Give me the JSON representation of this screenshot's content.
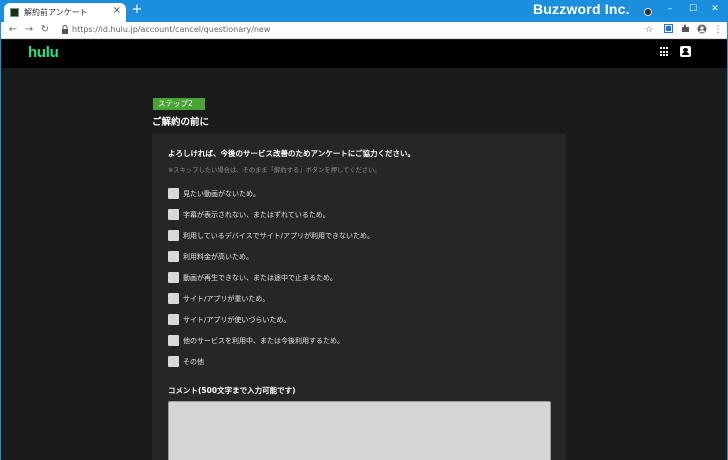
{
  "browser": {
    "tab_title": "解約前アンケート",
    "tab_close": "×",
    "new_tab": "+",
    "url": "https://id.hulu.jp/account/cancel/questionary/new",
    "watermark": "Buzzword Inc.",
    "window_controls": {
      "minimize": "–",
      "maximize": "☐",
      "close": "✕"
    },
    "nav": {
      "back": "←",
      "forward": "→",
      "reload": "↻"
    },
    "icons": [
      "star-icon",
      "extension-icon",
      "puzzle-icon",
      "profile-icon",
      "kebab-menu-icon"
    ],
    "accent": "#1c8fdc"
  },
  "site": {
    "logo": "hulu",
    "brand_color": "#1ce783",
    "header_icons": [
      "apps-grid-icon",
      "user-account-icon"
    ]
  },
  "form": {
    "step_label": "ステップ2",
    "title": "ご解約の前に",
    "lead": "よろしければ、今後のサービス改善のためアンケートにご協力ください。",
    "note": "※スキップしたい場合は、そのまま「解約する」ボタンを押してください。",
    "options": [
      "見たい動画がないため。",
      "字幕が表示されない、またはずれているため。",
      "利用しているデバイスでサイト/アプリが利用できないため。",
      "利用料金が高いため。",
      "動画が再生できない、または途中で止まるため。",
      "サイト/アプリが重いため。",
      "サイト/アプリが使いづらいため。",
      "他のサービスを利用中、または今後利用するため。",
      "その他"
    ],
    "comment_label": "コメント(500文字まで入力可能です)",
    "comment_value": ""
  }
}
